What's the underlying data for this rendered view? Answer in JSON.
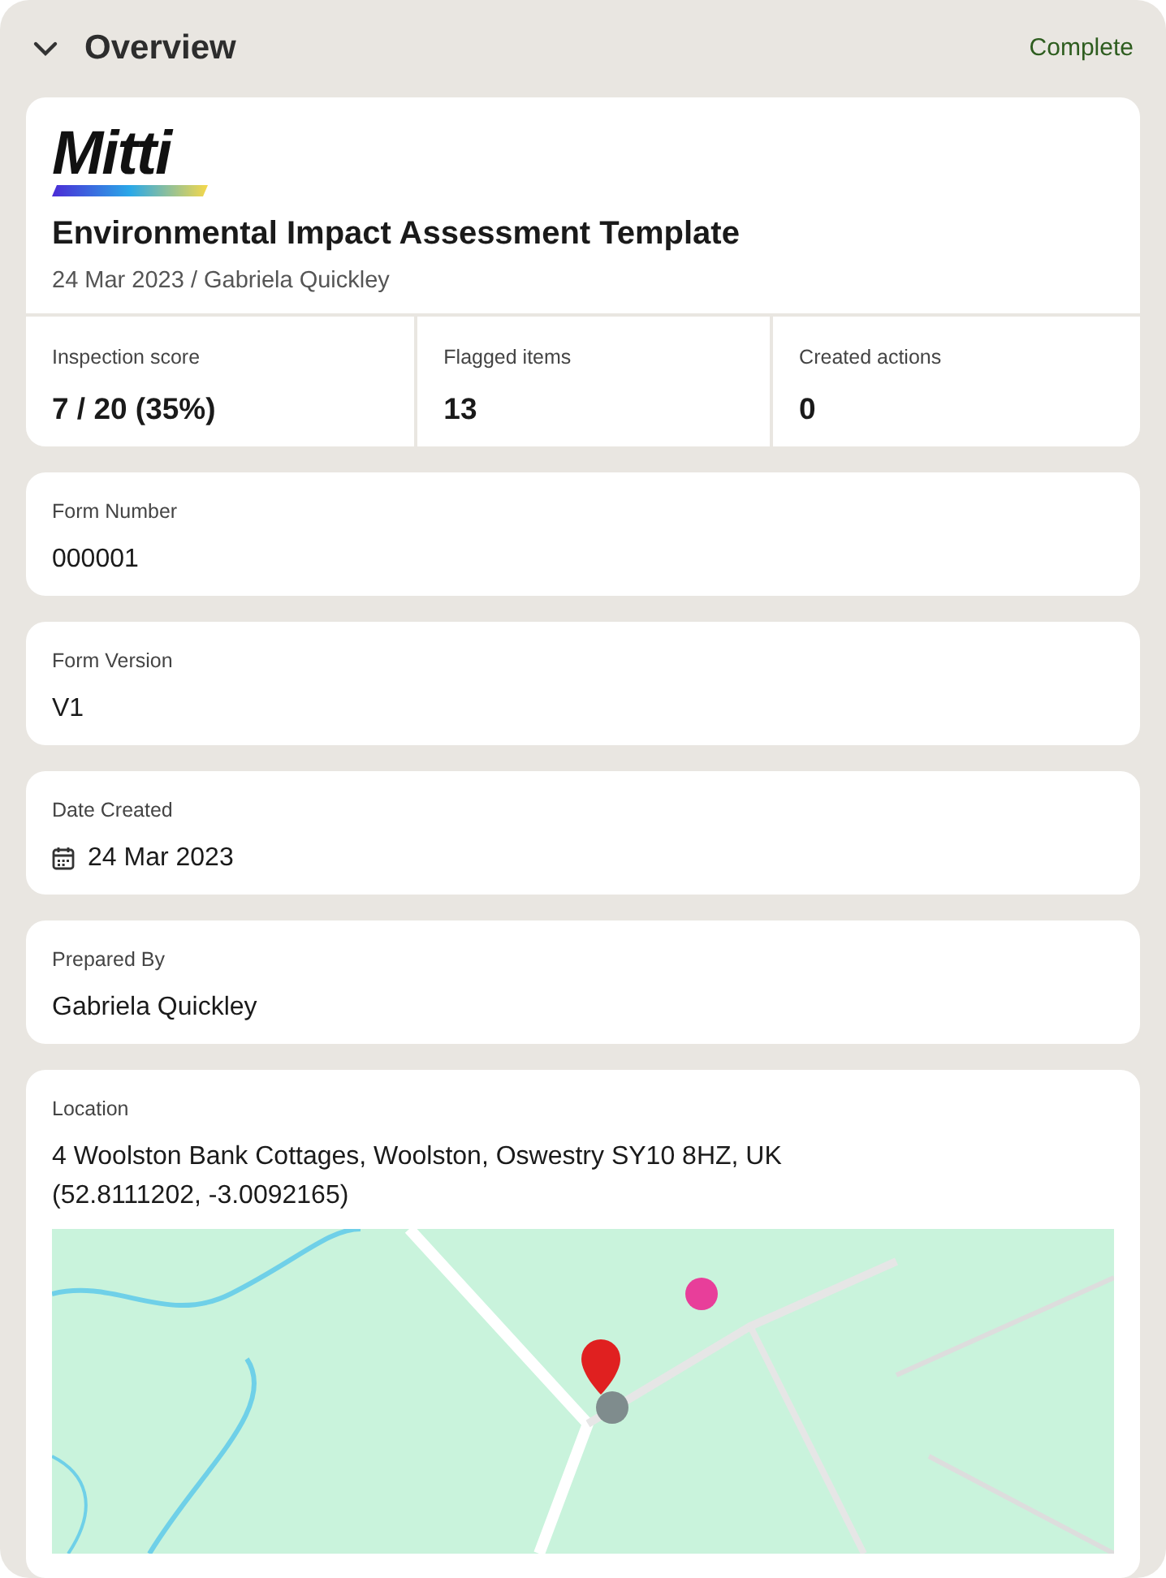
{
  "section": {
    "title": "Overview",
    "expanded": true,
    "status": "Complete"
  },
  "header": {
    "logo": "Mitti",
    "title": "Environmental Impact Assessment Template",
    "subtitle": "24 Mar 2023 / Gabriela Quickley"
  },
  "stats": [
    {
      "label": "Inspection score",
      "value": "7 / 20 (35%)"
    },
    {
      "label": "Flagged items",
      "value": "13"
    },
    {
      "label": "Created actions",
      "value": "0"
    }
  ],
  "fields": [
    {
      "kind": "text",
      "label": "Form Number",
      "value": "000001"
    },
    {
      "kind": "text",
      "label": "Form Version",
      "value": "V1"
    },
    {
      "kind": "date",
      "label": "Date Created",
      "value": "24 Mar 2023"
    },
    {
      "kind": "text",
      "label": "Prepared By",
      "value": "Gabriela Quickley"
    },
    {
      "kind": "location",
      "label": "Location",
      "value": "4 Woolston Bank Cottages, Woolston, Oswestry SY10 8HZ, UK",
      "coordinates": "(52.8111202, -3.0092165)"
    }
  ]
}
